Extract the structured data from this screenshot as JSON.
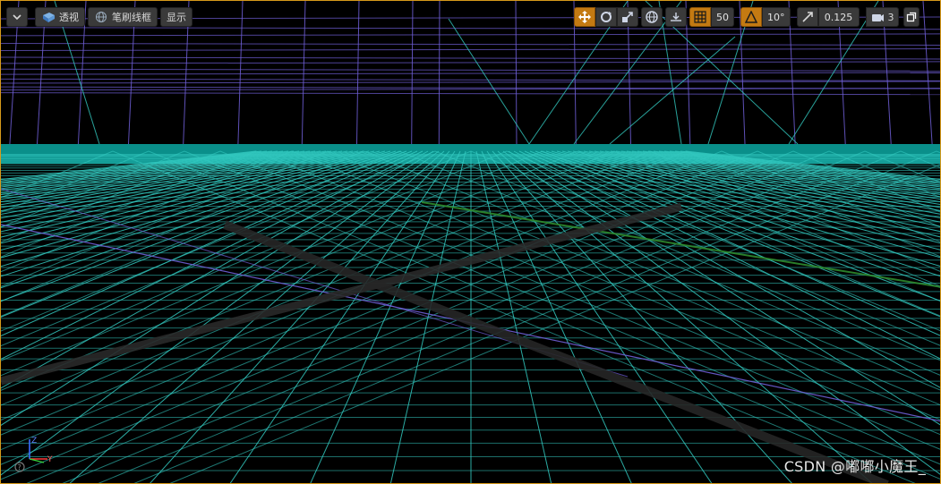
{
  "toolbar": {
    "view_mode_label": "透视",
    "render_mode_label": "笔刷线框",
    "show_label": "显示",
    "grid_snap_value": "50",
    "rotation_snap_value": "10°",
    "scale_snap_value": "0.125",
    "camera_speed_value": "3"
  },
  "icons": {
    "menu": "chevron-down-icon",
    "perspective": "perspective-cube-icon",
    "wireframe": "wireframe-sphere-icon",
    "translate": "translate-icon",
    "rotate": "rotate-icon",
    "scale": "scale-icon",
    "world": "globe-icon",
    "surface_snap": "surface-snap-icon",
    "grid_snap": "grid-icon",
    "rotation_snap": "angle-icon",
    "scale_snap": "scale-arrow-icon",
    "camera_speed": "camera-icon",
    "maximize": "maximize-icon"
  },
  "colors": {
    "viewport_border": "#d79a1a",
    "active_button": "#c47a12",
    "ground_teal": "#0a8f8a",
    "wire_purple": "#6f5fd6",
    "wire_cyan": "#33c9c0"
  },
  "axis": {
    "z": "Z",
    "y": "Y"
  },
  "watermark": "CSDN @嘟嘟小魔王_"
}
